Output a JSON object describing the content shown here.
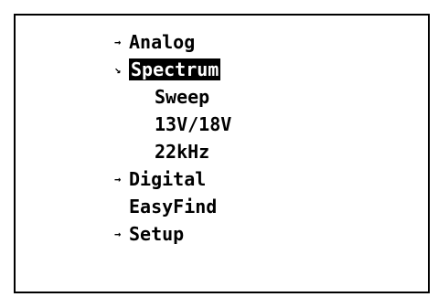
{
  "menu": {
    "items": [
      {
        "icon": "right-arrow-icon",
        "arrow": "→",
        "label": "Analog"
      },
      {
        "icon": "down-right-arrow-icon",
        "arrow": "↘",
        "label": "Spectrum",
        "selected": true
      },
      {
        "label": "Sweep"
      },
      {
        "label": "13V/18V"
      },
      {
        "label": "22kHz"
      },
      {
        "icon": "right-arrow-icon",
        "arrow": "→",
        "label": "Digital"
      },
      {
        "label": "EasyFind"
      },
      {
        "icon": "right-arrow-icon",
        "arrow": "→",
        "label": "Setup"
      }
    ]
  }
}
